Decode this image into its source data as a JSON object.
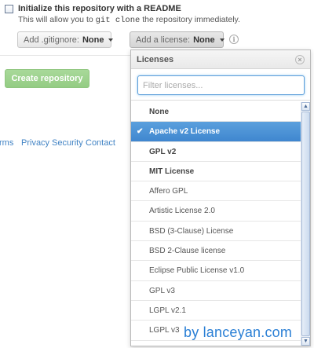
{
  "readme": {
    "title": "Initialize this repository with a README",
    "desc_before": "This will allow you to ",
    "desc_code": "git clone",
    "desc_after": " the repository immediately.",
    "checked": false
  },
  "gitignore": {
    "label": "Add .gitignore:",
    "value": "None"
  },
  "license_button": {
    "label": "Add a license:",
    "value": "None"
  },
  "info_icon": "i",
  "create_button": "Create repository",
  "footer_links": [
    "rms",
    "Privacy",
    "Security",
    "Contact"
  ],
  "license_menu": {
    "title": "Licenses",
    "close": "×",
    "filter_placeholder": "Filter licenses...",
    "items": [
      {
        "label": "None",
        "bold": true,
        "selected": false
      },
      {
        "label": "Apache v2 License",
        "bold": true,
        "selected": true
      },
      {
        "label": "GPL v2",
        "bold": true,
        "selected": false
      },
      {
        "label": "MIT License",
        "bold": true,
        "selected": false
      },
      {
        "label": "Affero GPL",
        "bold": false,
        "selected": false
      },
      {
        "label": "Artistic License 2.0",
        "bold": false,
        "selected": false
      },
      {
        "label": "BSD (3-Clause) License",
        "bold": false,
        "selected": false
      },
      {
        "label": "BSD 2-Clause license",
        "bold": false,
        "selected": false
      },
      {
        "label": "Eclipse Public License v1.0",
        "bold": false,
        "selected": false
      },
      {
        "label": "GPL v3",
        "bold": false,
        "selected": false
      },
      {
        "label": "LGPL v2.1",
        "bold": false,
        "selected": false
      },
      {
        "label": "LGPL v3",
        "bold": false,
        "selected": false
      }
    ],
    "check_glyph": "✔"
  },
  "scrollbar": {
    "up": "▲",
    "down": "▼"
  },
  "watermark": "by lanceyan.com"
}
